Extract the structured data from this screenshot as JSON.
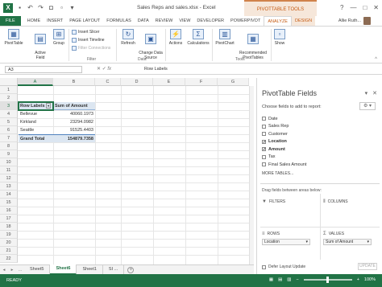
{
  "window": {
    "title": "Sales Reps and sales.xlsx - Excel",
    "context_tools": "PIVOTTABLE TOOLS",
    "controls": [
      "?",
      "—",
      "□",
      "✕"
    ]
  },
  "tabs": [
    {
      "label": "FILE"
    },
    {
      "label": "HOME"
    },
    {
      "label": "INSERT"
    },
    {
      "label": "PAGE LAYOUT"
    },
    {
      "label": "FORMULAS"
    },
    {
      "label": "DATA"
    },
    {
      "label": "REVIEW"
    },
    {
      "label": "VIEW"
    },
    {
      "label": "DEVELOPER"
    },
    {
      "label": "POWERPIVOT"
    }
  ],
  "ctx_tabs": [
    {
      "label": "ANALYZE"
    },
    {
      "label": "DESIGN"
    }
  ],
  "user": {
    "name": "Allie Ruth..."
  },
  "ribbon": {
    "pivottable": "PivotTable",
    "active_field": "Active\nField",
    "group": "Group",
    "insert_slicer": "Insert Slicer",
    "insert_timeline": "Insert Timeline",
    "filter_connections": "Filter Connections",
    "filter_group": "Filter",
    "refresh": "Refresh",
    "change_data_source": "Change Data\nSource",
    "data_group": "Data",
    "actions": "Actions",
    "calculations": "Calculations",
    "pivotchart": "PivotChart",
    "recommended": "Recommended\nPivotTables",
    "tools_group": "Tools",
    "show": "Show"
  },
  "formula_bar": {
    "namebox": "A3",
    "fx": "fx",
    "value": "Row Labels"
  },
  "grid": {
    "columns": [
      "A",
      "B",
      "C",
      "D",
      "E",
      "F",
      "G"
    ],
    "rows": [
      "1",
      "2",
      "3",
      "4",
      "5",
      "6",
      "7",
      "8",
      "9",
      "10",
      "11",
      "12",
      "13",
      "14",
      "15",
      "16",
      "17",
      "18",
      "19",
      "20",
      "21",
      "22"
    ],
    "pivot": {
      "header": [
        "Row Labels",
        "Sum of Amount"
      ],
      "data": [
        [
          "Bellevue",
          "40060.1973"
        ],
        [
          "Kirkland",
          "23294.0982"
        ],
        [
          "Seattle",
          "91525.4403"
        ]
      ],
      "total": [
        "Grand Total",
        "154879.7358"
      ]
    }
  },
  "sheets": [
    {
      "label": "Sheet5"
    },
    {
      "label": "Sheet6"
    },
    {
      "label": "Sheet1"
    },
    {
      "label": "SI ..."
    }
  ],
  "status": {
    "ready": "READY",
    "zoom": "100%"
  },
  "pane": {
    "title": "PivotTable Fields",
    "subtitle": "Choose fields to add to report:",
    "fields": [
      {
        "label": "Date",
        "checked": false
      },
      {
        "label": "Sales Rep",
        "checked": false
      },
      {
        "label": "Customer",
        "checked": false
      },
      {
        "label": "Location",
        "checked": true
      },
      {
        "label": "Amount",
        "checked": true
      },
      {
        "label": "Tax",
        "checked": false
      },
      {
        "label": "Final Sales Amount",
        "checked": false
      }
    ],
    "more_tables": "MORE TABLES...",
    "drag_label": "Drag fields between areas below:",
    "filters": "FILTERS",
    "columns": "COLUMNS",
    "rows": "ROWS",
    "values": "VALUES",
    "rows_item": "Location",
    "values_item": "Sum of Amount",
    "defer": "Defer Layout Update",
    "update": "UPDATE"
  },
  "colors": {
    "excel_green": "#217346",
    "context_orange": "#c55a11",
    "pivot_header": "#dce6f1"
  }
}
